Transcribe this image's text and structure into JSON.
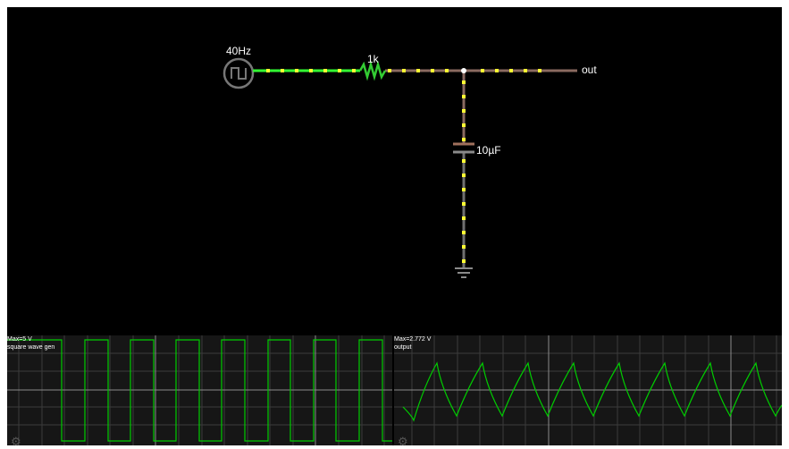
{
  "circuit": {
    "source_label": "40Hz",
    "resistor_label": "1k",
    "capacitor_label": "10µF",
    "output_label": "out"
  },
  "scope1": {
    "max_label": "Max=5 V",
    "name": "square wave gen",
    "waveform": "square",
    "trace_color": "#00cc00"
  },
  "scope2": {
    "max_label": "Max=2.772 V",
    "name": "output",
    "waveform": "rc-charge-discharge",
    "trace_color": "#00cc00"
  },
  "icons": {
    "source": "square-wave-source-icon",
    "resistor": "resistor-icon",
    "capacitor": "capacitor-icon",
    "ground": "ground-icon",
    "settings": "gear-icon"
  },
  "colors": {
    "background": "#000000",
    "wire_high": "#33ff33",
    "wire_low": "#8a6a60",
    "current_dot": "#ffff33",
    "trace": "#00cc00"
  }
}
